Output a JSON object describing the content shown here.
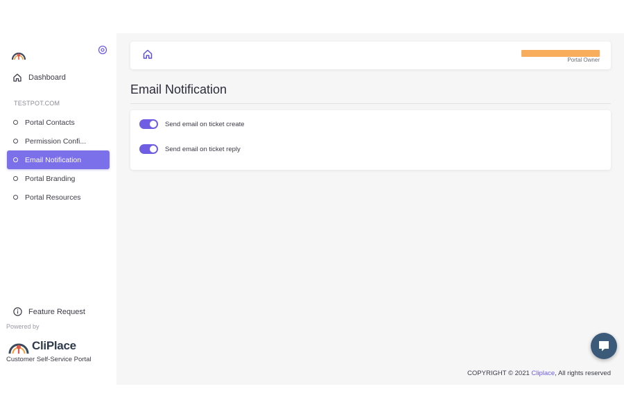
{
  "sidebar": {
    "dashboard_label": "Dashboard",
    "section_label": "TESTPOT.COM",
    "items": [
      {
        "label": "Portal Contacts",
        "active": false
      },
      {
        "label": "Permission Confi...",
        "active": false
      },
      {
        "label": "Email Notification",
        "active": true
      },
      {
        "label": "Portal Branding",
        "active": false
      },
      {
        "label": "Portal Resources",
        "active": false
      }
    ],
    "feature_request_label": "Feature Request",
    "powered_by": "Powered by",
    "brand_name": "CliPlace",
    "tagline": "Customer Self-Service Portal"
  },
  "header": {
    "user_role": "Portal Owner",
    "user_name_redacted_color": "#f8ad5c"
  },
  "main": {
    "title": "Email Notification",
    "settings": [
      {
        "label": "Send email on ticket create",
        "enabled": true
      },
      {
        "label": "Send email on ticket reply",
        "enabled": true
      }
    ]
  },
  "footer": {
    "copyright_prefix": "COPYRIGHT © 2021 ",
    "copyright_link": "Cliplace",
    "copyright_suffix": ", All rights reserved"
  },
  "colors": {
    "accent": "#6f5ee4",
    "active_nav": "#7b6fea",
    "chat_button": "#3b5a7a"
  },
  "icons": {
    "logo": "cliplace-logo-icon",
    "collapse": "collapse-sidebar-icon",
    "dashboard": "home-icon",
    "feature_request": "info-icon",
    "home": "home-icon",
    "chat": "chat-bubble-icon"
  }
}
